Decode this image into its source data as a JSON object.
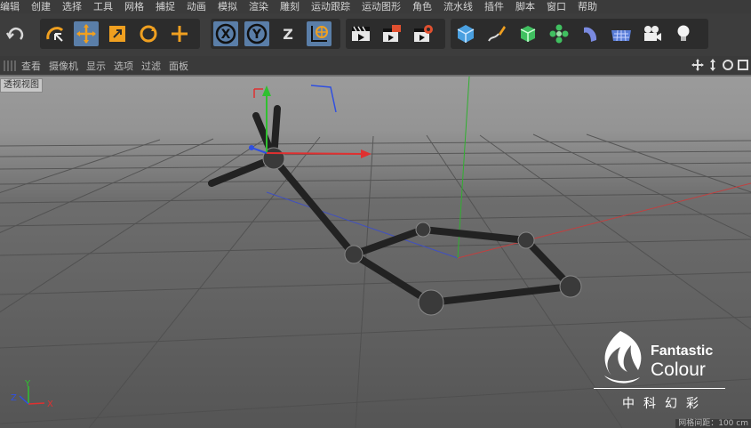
{
  "menu": {
    "items": [
      "编辑",
      "创建",
      "选择",
      "工具",
      "网格",
      "捕捉",
      "动画",
      "模拟",
      "渲染",
      "雕刻",
      "运动跟踪",
      "运动图形",
      "角色",
      "流水线",
      "插件",
      "脚本",
      "窗口",
      "帮助"
    ]
  },
  "toolbar": {
    "undo_icon": "undo-icon",
    "tools": [
      {
        "name": "live-selection-icon",
        "active": false
      },
      {
        "name": "move-icon",
        "active": true
      },
      {
        "name": "scale-icon",
        "active": false
      },
      {
        "name": "rotate-icon",
        "active": false
      },
      {
        "name": "move-plus-icon",
        "active": false
      }
    ],
    "axis_x": "X",
    "axis_y": "Y",
    "axis_z": "Z",
    "coord_icon": "world-coordinate-icon",
    "render": [
      "render-view-icon",
      "render-to-picture-viewer-icon",
      "render-settings-icon"
    ],
    "objects": [
      "cube-icon",
      "pen-spline-icon",
      "subdivision-icon",
      "array-icon",
      "deformer-icon",
      "floor-icon",
      "camera-icon",
      "light-icon"
    ]
  },
  "viewport_menu": {
    "items": [
      "查看",
      "摄像机",
      "显示",
      "选项",
      "过滤",
      "面板"
    ]
  },
  "viewport": {
    "label": "透视视图",
    "grid_info": "网格间距：100 cm",
    "axis_labels": {
      "x": "X",
      "y": "Y",
      "z": "Z"
    }
  },
  "logo": {
    "line1": "Fantastic",
    "line2": "Colour",
    "cn": "中科幻彩"
  },
  "colors": {
    "active_tool": "#5a7ea8",
    "axis_x": "#e03030",
    "axis_y": "#30c030",
    "axis_z": "#3050e0",
    "orange_icon": "#f0a020"
  }
}
